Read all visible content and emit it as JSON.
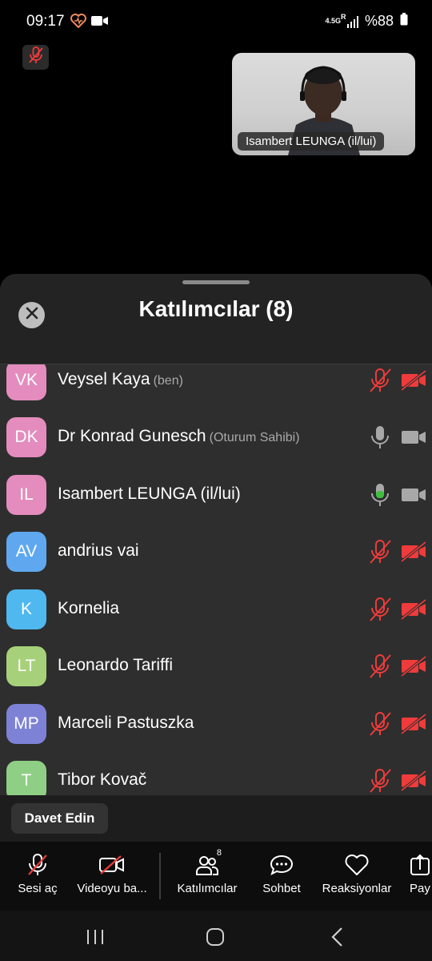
{
  "status_bar": {
    "time": "09:17",
    "net_top": "4.5G",
    "net_bottom": "R",
    "battery": "%88"
  },
  "video": {
    "label": "Isambert LEUNGA (il/lui)"
  },
  "sheet": {
    "title": "Katılımcılar (8)"
  },
  "participants": [
    {
      "initials": "VK",
      "name": "Veysel Kaya",
      "note": "(ben)",
      "avatar_color": "#e48cbd",
      "mic": "muted",
      "cam": "off"
    },
    {
      "initials": "DK",
      "name": "Dr Konrad Gunesch",
      "note": "(Oturum Sahibi)",
      "avatar_color": "#e48cbd",
      "mic": "on",
      "cam": "on"
    },
    {
      "initials": "IL",
      "name": "Isambert LEUNGA (il/lui)",
      "note": "",
      "avatar_color": "#e48cbd",
      "mic": "speaking",
      "cam": "on"
    },
    {
      "initials": "AV",
      "name": "andrius vai",
      "note": "",
      "avatar_color": "#5fa8ef",
      "mic": "muted",
      "cam": "off"
    },
    {
      "initials": "K",
      "name": "Kornelia",
      "note": "",
      "avatar_color": "#4fb8ef",
      "mic": "muted",
      "cam": "off"
    },
    {
      "initials": "LT",
      "name": "Leonardo Tariffi",
      "note": "",
      "avatar_color": "#a6d17a",
      "mic": "muted",
      "cam": "off"
    },
    {
      "initials": "MP",
      "name": "Marceli Pastuszka",
      "note": "",
      "avatar_color": "#7d82d6",
      "mic": "muted",
      "cam": "off"
    },
    {
      "initials": "T",
      "name": "Tibor Kovač",
      "note": "",
      "avatar_color": "#8fcf85",
      "mic": "muted",
      "cam": "off"
    }
  ],
  "invite": {
    "label": "Davet Edin"
  },
  "toolbar": {
    "unmute": "Sesi aç",
    "video": "Videoyu ba...",
    "participants": "Katılımcılar",
    "participants_count": "8",
    "chat": "Sohbet",
    "reactions": "Reaksiyonlar",
    "share": "Pay"
  },
  "colors": {
    "muted_red": "#ef3b3b",
    "speaking_green": "#3fbf3f",
    "icon_gray": "#a8a8a8"
  }
}
